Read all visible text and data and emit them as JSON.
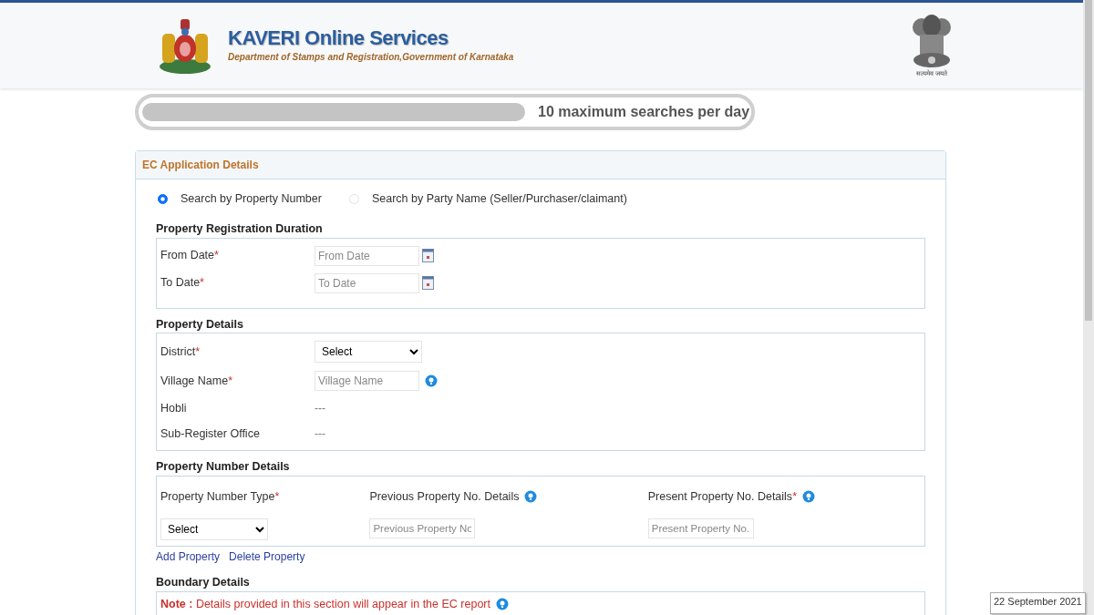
{
  "header": {
    "title": "KAVERI Online Services",
    "subtitle": "Department of Stamps and Registration,Government of Karnataka",
    "motto": "सत्यमेव जयते"
  },
  "search_limit": {
    "text": "10 maximum searches per day"
  },
  "panel": {
    "title": "EC Application Details",
    "search_modes": [
      {
        "label": "Search by Property Number",
        "selected": true
      },
      {
        "label": "Search by Party Name (Seller/Purchaser/claimant)",
        "selected": false
      }
    ],
    "duration": {
      "title": "Property Registration Duration",
      "fields": [
        {
          "label": "From Date",
          "required_mark": "*",
          "placeholder": "From Date"
        },
        {
          "label": "To Date",
          "required_mark": "*",
          "placeholder": "To Date"
        }
      ]
    },
    "property_details": {
      "title": "Property Details",
      "rows": [
        {
          "kind": "select",
          "label": "District",
          "required_mark": "*",
          "value": "Select"
        },
        {
          "kind": "input",
          "label": "Village Name",
          "required_mark": "*",
          "placeholder": "Village Name",
          "info": true
        },
        {
          "kind": "text",
          "label": "Hobli",
          "value": "---"
        },
        {
          "kind": "text",
          "label": "Sub-Register Office",
          "value": "---"
        }
      ]
    },
    "property_number": {
      "title": "Property Number Details",
      "columns": [
        {
          "kind": "select",
          "label": "Property Number Type",
          "required_mark": "*",
          "value": "Select"
        },
        {
          "kind": "input",
          "label": "Previous Property No. Details",
          "info": true,
          "placeholder": "Previous Property No"
        },
        {
          "kind": "input",
          "label": "Present Property No. Details",
          "required_mark": "*",
          "info": true,
          "placeholder": "Present Property No."
        }
      ],
      "links": [
        "Add Property",
        "Delete Property"
      ]
    },
    "boundary": {
      "title": "Boundary Details",
      "note_label": "Note :",
      "note_text": "Details provided in this section will appear in the EC report",
      "info": true
    }
  },
  "tooltip": {
    "text": "22 September 2021"
  }
}
